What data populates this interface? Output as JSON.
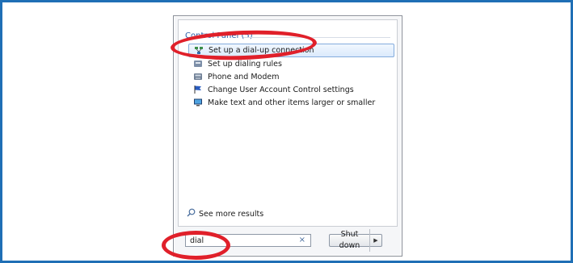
{
  "start_menu": {
    "results_group": {
      "header": "Control Panel (5)",
      "items": [
        {
          "label": "Set up a dial-up connection",
          "icon": "network-connection-icon"
        },
        {
          "label": "Set up dialing rules",
          "icon": "phone-rules-icon"
        },
        {
          "label": "Phone and Modem",
          "icon": "phone-modem-icon"
        },
        {
          "label": "Change User Account Control settings",
          "icon": "uac-flag-icon"
        },
        {
          "label": "Make text and other items larger or smaller",
          "icon": "display-icon"
        }
      ]
    },
    "see_more": "See more results",
    "search": {
      "value": "dial",
      "clear": "×"
    },
    "shutdown": {
      "label": "Shut down",
      "arrow": "▶"
    }
  },
  "colors": {
    "frame": "#1f6fb5",
    "annotation": "#e0202a",
    "selection": "#dbeafc"
  }
}
